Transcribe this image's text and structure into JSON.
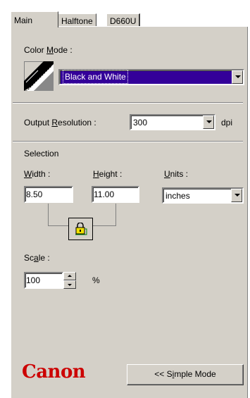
{
  "tabs": [
    {
      "label": "Main"
    },
    {
      "label": "Halftone"
    },
    {
      "label": "D660U"
    }
  ],
  "color_mode": {
    "label_pre": "Color ",
    "label_u": "M",
    "label_post": "ode :",
    "value": "Black and White"
  },
  "output_resolution": {
    "label_pre": "Output ",
    "label_u": "R",
    "label_post": "esolution :",
    "value": "300",
    "unit": "dpi"
  },
  "selection": {
    "title": "Selection",
    "width": {
      "label_u": "W",
      "label_post": "idth :",
      "value": "8.50"
    },
    "height": {
      "label_u": "H",
      "label_post": "eight :",
      "value": "11.00"
    },
    "units": {
      "label_u": "U",
      "label_post": "nits :",
      "value": "inches"
    }
  },
  "scale": {
    "label_pre": "Sc",
    "label_u": "a",
    "label_post": "le :",
    "value": "100",
    "unit": "%"
  },
  "brand": "Canon",
  "simple_mode": {
    "pre": "<< S",
    "u": "i",
    "post": "mple Mode"
  },
  "colors": {
    "selection_highlight": "#330099",
    "brand_red": "#cc0000",
    "panel_bg": "#d4d0c8"
  }
}
